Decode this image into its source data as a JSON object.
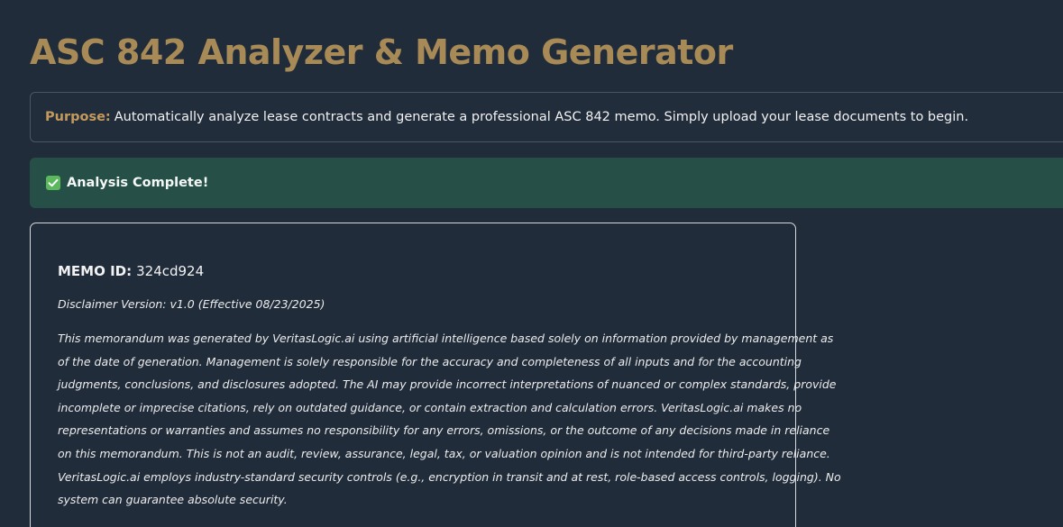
{
  "page": {
    "title": "ASC 842 Analyzer & Memo Generator"
  },
  "purpose": {
    "label": "Purpose:",
    "text": "Automatically analyze lease contracts and generate a professional ASC 842 memo. Simply upload your lease documents to begin."
  },
  "status": {
    "icon": "check-mark-button-icon",
    "text": "Analysis Complete!"
  },
  "memo": {
    "id_label": "MEMO ID:",
    "id_value": "324cd924",
    "disclaimer_version": "Disclaimer Version: v1.0 (Effective 08/23/2025)",
    "disclaimer_lines": [
      "This memorandum was generated by VeritasLogic.ai using artificial intelligence based solely on information provided by management as",
      "of the date of generation. Management is solely responsible for the accuracy and completeness of all inputs and for the accounting",
      "judgments, conclusions, and disclosures adopted. The AI may provide incorrect interpretations of nuanced or complex standards, provide",
      "incomplete or imprecise citations, rely on outdated guidance, or contain extraction and calculation errors. VeritasLogic.ai makes no",
      "representations or warranties and assumes no responsibility for any errors, omissions, or the outcome of any decisions made in reliance",
      "on this memorandum. This is not an audit, review, assurance, legal, tax, or valuation opinion and is not intended for third-party reliance.",
      "VeritasLogic.ai employs industry-standard security controls (e.g., encryption in transit and at rest, role-based access controls, logging). No",
      "system can guarantee absolute security."
    ]
  },
  "colors": {
    "background": "#212c3b",
    "title": "#a88a56",
    "purpose_label": "#c49a5c",
    "success_bg": "#264f47",
    "check_green": "#5cb85c"
  }
}
